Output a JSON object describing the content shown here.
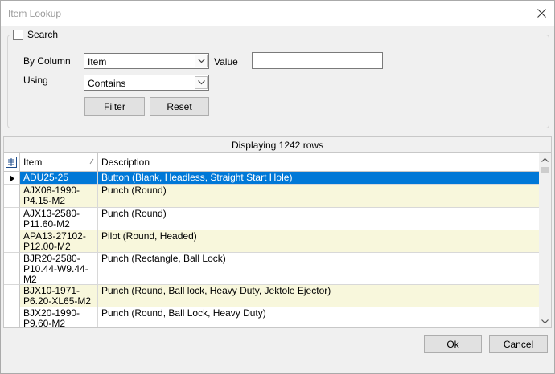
{
  "window": {
    "title": "Item Lookup"
  },
  "search": {
    "group_label": "Search",
    "by_column_label": "By Column",
    "by_column_value": "Item",
    "value_label": "Value",
    "value_text": "",
    "using_label": "Using",
    "using_value": "Contains",
    "filter_label": "Filter",
    "reset_label": "Reset"
  },
  "grid": {
    "status": "Displaying 1242 rows",
    "columns": [
      "Item",
      "Description"
    ],
    "rows": [
      {
        "item": "ADU25-25",
        "description": "Button (Blank, Headless, Straight Start Hole)"
      },
      {
        "item": "AJX08-1990-P4.15-M2",
        "description": "Punch (Round)"
      },
      {
        "item": "AJX13-2580-P11.60-M2",
        "description": "Punch (Round)"
      },
      {
        "item": "APA13-27102-P12.00-M2",
        "description": "Pilot (Round, Headed)"
      },
      {
        "item": "BJR20-2580-P10.44-W9.44-M2",
        "description": "Punch (Rectangle, Ball Lock)"
      },
      {
        "item": "BJX10-1971-P6.20-XL65-M2",
        "description": "Punch (Round, Ball lock, Heavy Duty, Jektole Ejector)"
      },
      {
        "item": "BJX20-1990-P9.60-M2",
        "description": "Punch (Round, Ball Lock, Heavy Duty)"
      }
    ]
  },
  "footer": {
    "ok_label": "Ok",
    "cancel_label": "Cancel"
  },
  "colors": {
    "selection": "#0078d7",
    "alt_row": "#f8f7dc",
    "window_bg": "#f0f0f0"
  }
}
